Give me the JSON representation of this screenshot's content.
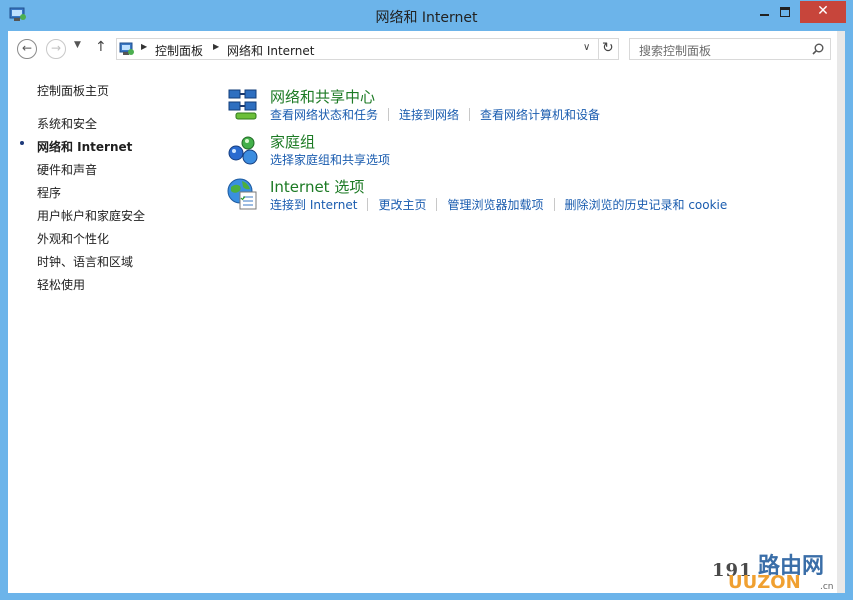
{
  "window": {
    "title": "网络和 Internet",
    "close_glyph": "✕"
  },
  "nav": {
    "back_glyph": "←",
    "forward_glyph": "→",
    "recent_glyph": "▼",
    "up_glyph": "↑",
    "breadcrumbs": [
      "控制面板",
      "网络和 Internet"
    ],
    "crumb_sep": "▶",
    "dropdown_glyph": "∨",
    "refresh_glyph": "↻",
    "search_placeholder": "搜索控制面板"
  },
  "sidebar": {
    "home": "控制面板主页",
    "items": [
      {
        "label": "系统和安全",
        "current": false
      },
      {
        "label": "网络和 Internet",
        "current": true
      },
      {
        "label": "硬件和声音",
        "current": false
      },
      {
        "label": "程序",
        "current": false
      },
      {
        "label": "用户帐户和家庭安全",
        "current": false
      },
      {
        "label": "外观和个性化",
        "current": false
      },
      {
        "label": "时钟、语言和区域",
        "current": false
      },
      {
        "label": "轻松使用",
        "current": false
      }
    ]
  },
  "categories": [
    {
      "title": "网络和共享中心",
      "icon": "network-center-icon",
      "tasks": [
        "查看网络状态和任务",
        "连接到网络",
        "查看网络计算机和设备"
      ]
    },
    {
      "title": "家庭组",
      "icon": "homegroup-icon",
      "tasks": [
        "选择家庭组和共享选项"
      ]
    },
    {
      "title": "Internet 选项",
      "icon": "internet-options-icon",
      "tasks": [
        "连接到 Internet",
        "更改主页",
        "管理浏览器加载项",
        "删除浏览的历史记录和 cookie"
      ]
    }
  ],
  "watermark": {
    "digits": "191",
    "text": "路由网",
    "sub": "UUZON",
    "domain": ".cn"
  },
  "colors": {
    "frame": "#6cb4ea",
    "close": "#c7453b",
    "category_title": "#1c7a24",
    "link": "#1a5caf"
  }
}
